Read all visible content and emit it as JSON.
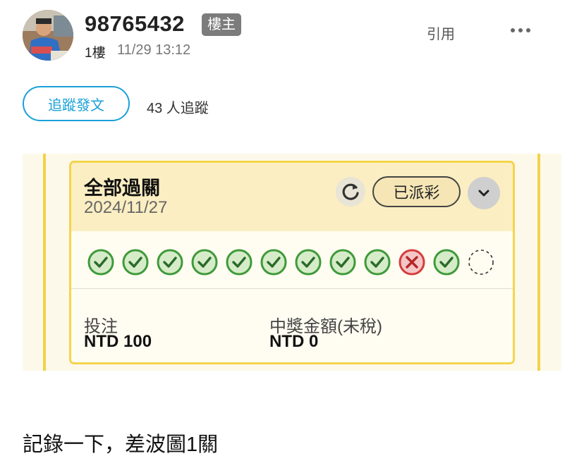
{
  "author": {
    "username": "98765432",
    "badge": "樓主",
    "floor": "1樓",
    "time": "11/29 13:12"
  },
  "actions": {
    "quote": "引用",
    "more_icon": "ellipsis-icon"
  },
  "follow": {
    "button_label": "追蹤發文",
    "count_text": "43 人追蹤"
  },
  "bet_card": {
    "title": "全部過關",
    "date": "2024/11/27",
    "status": "已派彩",
    "results": [
      "win",
      "win",
      "win",
      "win",
      "win",
      "win",
      "win",
      "win",
      "win",
      "loss",
      "win",
      "pending"
    ],
    "stake_label": "投注",
    "stake_value": "NTD 100",
    "prize_label": "中獎金額(未稅)",
    "prize_value": "NTD 0"
  },
  "post": {
    "body": "記錄一下，差波圖1關"
  },
  "colors": {
    "accent_blue": "#1aa0d8",
    "win_green": "#3f9a3a",
    "loss_red": "#d43d3d",
    "card_border": "#f4d44c"
  }
}
